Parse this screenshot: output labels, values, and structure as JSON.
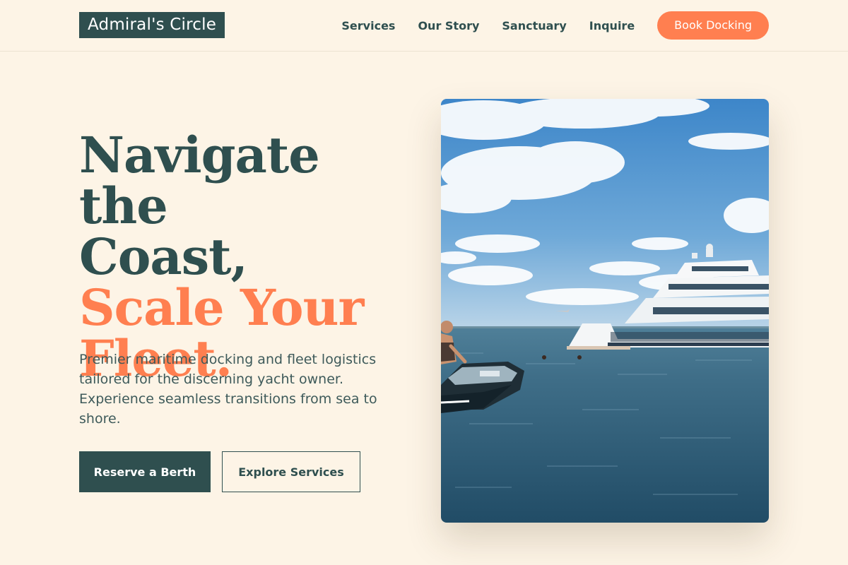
{
  "brand": {
    "name": "Admiral's Circle"
  },
  "nav": {
    "items": [
      {
        "label": "Services"
      },
      {
        "label": "Our Story"
      },
      {
        "label": "Sanctuary"
      },
      {
        "label": "Inquire"
      }
    ],
    "cta_label": "Book Docking"
  },
  "hero": {
    "headline_line1": "Navigate the",
    "headline_line2": "Coast,",
    "headline_accent_line1": "Scale Your",
    "headline_accent_line2": "Fleet.",
    "subtitle": "Premier maritime docking and fleet logistics tailored for the discerning yacht owner. Experience seamless transitions from sea to shore.",
    "primary_button": "Reserve a Berth",
    "secondary_button": "Explore Services",
    "image_subject": "yacht-and-jet-ski-on-sea-photo"
  },
  "colors": {
    "background": "#fdf4e6",
    "primary": "#2f4f4f",
    "accent": "#ff7f50"
  }
}
